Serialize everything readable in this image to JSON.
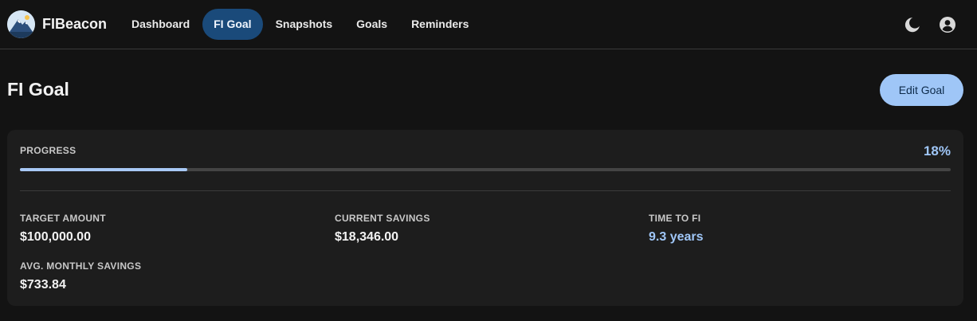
{
  "app": {
    "name": "FIBeacon"
  },
  "nav": {
    "items": [
      {
        "label": "Dashboard",
        "active": false
      },
      {
        "label": "FI Goal",
        "active": true
      },
      {
        "label": "Snapshots",
        "active": false
      },
      {
        "label": "Goals",
        "active": false
      },
      {
        "label": "Reminders",
        "active": false
      }
    ]
  },
  "header_icons": {
    "theme": "moon-icon",
    "account": "account-circle-icon"
  },
  "page": {
    "title": "FI Goal",
    "edit_label": "Edit Goal"
  },
  "progress": {
    "label": "PROGRESS",
    "value_text": "18%",
    "fraction": 0.18
  },
  "stats": {
    "target": {
      "label": "TARGET AMOUNT",
      "value": "$100,000.00"
    },
    "current": {
      "label": "CURRENT SAVINGS",
      "value": "$18,346.00"
    },
    "time_to_fi": {
      "label": "TIME TO FI",
      "value": "9.3 years"
    },
    "monthly": {
      "label": "AVG. MONTHLY SAVINGS",
      "value": "$733.84"
    }
  },
  "colors": {
    "accent": "#9fc6f7",
    "active_nav": "#1a4a7a",
    "background": "#131313",
    "card": "#1d1d1d"
  }
}
